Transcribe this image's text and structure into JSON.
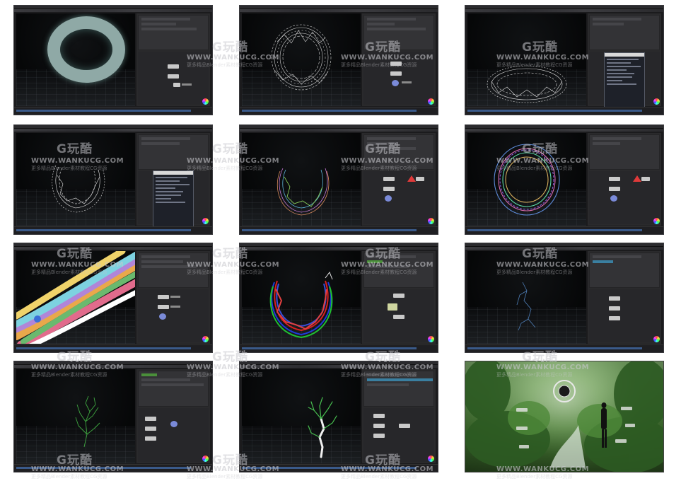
{
  "watermark": {
    "logo": "G玩酷",
    "site": "WWW.WANKUCG.COM",
    "subtitle": "更多精品Blender素材教程CG资源"
  },
  "thumbnails": [
    {
      "id": "1",
      "subject": "torus-ring"
    },
    {
      "id": "2",
      "subject": "wire-ring"
    },
    {
      "id": "3",
      "subject": "wire-ring-popup"
    },
    {
      "id": "4",
      "subject": "wire-ring-popup"
    },
    {
      "id": "5",
      "subject": "colored-wire-ring"
    },
    {
      "id": "6",
      "subject": "colored-wire-ring"
    },
    {
      "id": "7",
      "subject": "braided-tubes-closeup"
    },
    {
      "id": "8",
      "subject": "rgb-braid-ring"
    },
    {
      "id": "9",
      "subject": "sparse-curves"
    },
    {
      "id": "10",
      "subject": "green-plant-growth"
    },
    {
      "id": "11",
      "subject": "white-green-plant"
    },
    {
      "id": "12",
      "subject": "forest-render"
    }
  ],
  "colors": {
    "app_bg": "#1b1b1d",
    "panel_bg": "#2a2a2c",
    "accent_green": "#4a8f3a",
    "warning_red": "#e03a3a",
    "node_blue": "#7a8ad8"
  }
}
